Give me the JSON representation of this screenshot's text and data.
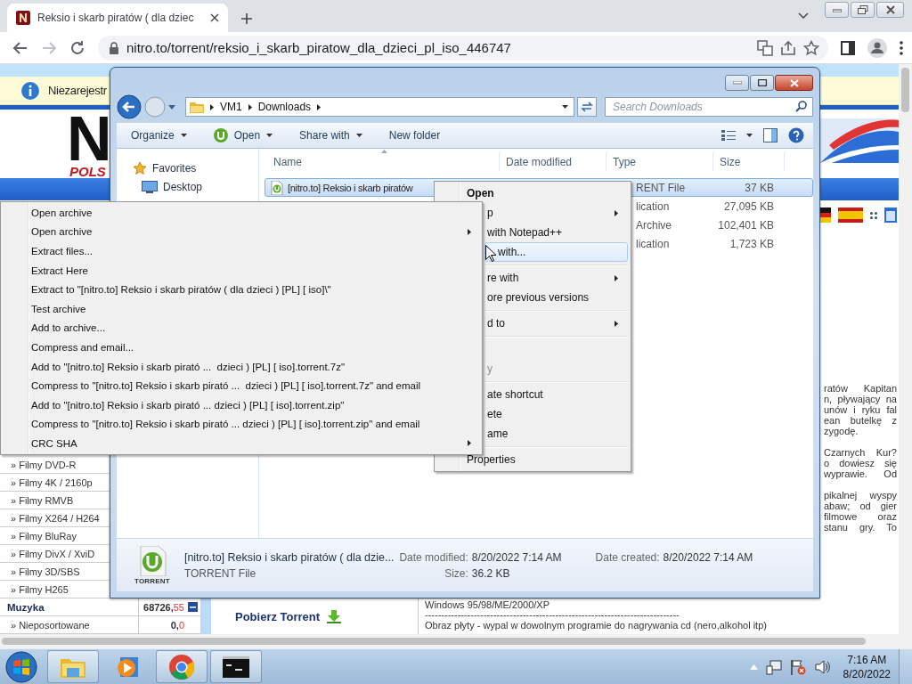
{
  "browser": {
    "tab_title": "Reksio i skarb piratów ( dla dziec",
    "url": "nitro.to/torrent/reksio_i_skarb_piratow_dla_dzieci_pl_iso_446747"
  },
  "site": {
    "info_bar": "Niezarejestr",
    "logo": "N",
    "logo_tagline": "POLS",
    "categories": [
      {
        "kind": "sub",
        "label": "» Filmy DVD-R"
      },
      {
        "kind": "sub",
        "label": "» Filmy 4K / 2160p"
      },
      {
        "kind": "sub",
        "label": "» Filmy RMVB"
      },
      {
        "kind": "sub",
        "label": "» Filmy X264 / H264"
      },
      {
        "kind": "sub",
        "label": "» Filmy BluRay"
      },
      {
        "kind": "sub",
        "label": "» Filmy DivX / XviD"
      },
      {
        "kind": "sub",
        "label": "» Filmy 3D/SBS"
      },
      {
        "kind": "sub",
        "label": "» Filmy H265"
      },
      {
        "kind": "main",
        "label": "Muzyka",
        "count": "68726,",
        "new": "55",
        "expanded": true
      },
      {
        "kind": "sub",
        "label": "» Nieposortowane",
        "count": "0,",
        "new": "0"
      }
    ],
    "download_link": "Pobierz Torrent",
    "description": [
      {
        "lines": [
          "ratów  Kapitan",
          "n, pływający na",
          "unów i ryku fal",
          "ean butelkę z",
          "zygodę."
        ]
      },
      {
        "lines": [
          "Czarnych Kur?",
          "o dowiesz się",
          "wyprawie. Od"
        ]
      },
      {
        "lines": [
          "pikalnej wyspy",
          "abaw; od gier",
          "filmowe oraz",
          "stanu gry. To"
        ]
      }
    ],
    "instructions": [
      "Windows 95/98/ME/2000/XP",
      "------------------------------------------------------------------------------",
      "Obraz płyty - wypal w dowolnym programie do nagrywania cd (nero,alkohol itp)"
    ]
  },
  "explorer": {
    "path": [
      "VM1",
      "Downloads"
    ],
    "search_placeholder": "Search Downloads",
    "toolbar": [
      {
        "label": "Organize",
        "kind": "plain",
        "dropdown": true
      },
      {
        "label": "Open",
        "kind": "app",
        "dropdown": true
      },
      {
        "label": "Share with",
        "kind": "plain",
        "dropdown": true
      },
      {
        "label": "New folder",
        "kind": "plain",
        "dropdown": false
      }
    ],
    "navigation": [
      {
        "kind": "favorites",
        "label": "Favorites"
      },
      {
        "kind": "desktop",
        "label": "Desktop"
      }
    ],
    "columns": [
      "Name",
      "Date modified",
      "Type",
      "Size"
    ],
    "files": [
      {
        "name": "[nitro.to] Reksio i skarb piratów",
        "type": "RENT File",
        "size": "37 KB",
        "selected": true
      },
      {
        "type": "lication",
        "size": "27,095 KB",
        "selected": false
      },
      {
        "type": "Archive",
        "size": "102,401 KB",
        "selected": false
      },
      {
        "type": "lication",
        "size": "1,723 KB",
        "selected": false
      }
    ],
    "details": {
      "icon_label": "TORRENT",
      "name": "[nitro.to] Reksio i skarb piratów ( dla dzie...",
      "type": "TORRENT File",
      "fields": [
        {
          "label": "Date modified:",
          "value": "8/20/2022 7:14 AM"
        },
        {
          "label": "Date created:",
          "value": "8/20/2022 7:14 AM"
        },
        {
          "label": "Size:",
          "value": "36.2 KB"
        }
      ]
    }
  },
  "context_menu": {
    "items": [
      {
        "kind": "item",
        "label": "Open",
        "default": true,
        "clipped": false,
        "submenu": false,
        "selected": false,
        "disabled": false
      },
      {
        "kind": "item",
        "label": "p",
        "default": false,
        "clipped": true,
        "submenu": true,
        "selected": false,
        "disabled": false
      },
      {
        "kind": "item",
        "label": "with Notepad++",
        "default": false,
        "clipped": true,
        "submenu": false,
        "selected": false,
        "disabled": false
      },
      {
        "kind": "item",
        "label": "with...",
        "default": false,
        "clipped": true,
        "submenu": false,
        "selected": true,
        "disabled": false
      },
      {
        "kind": "separator"
      },
      {
        "kind": "item",
        "label": "re with",
        "default": false,
        "clipped": true,
        "submenu": true,
        "selected": false,
        "disabled": false
      },
      {
        "kind": "item",
        "label": "ore previous versions",
        "default": false,
        "clipped": true,
        "submenu": false,
        "selected": false,
        "disabled": false
      },
      {
        "kind": "separator"
      },
      {
        "kind": "item",
        "label": "d to",
        "default": false,
        "clipped": true,
        "submenu": true,
        "selected": false,
        "disabled": false
      },
      {
        "kind": "separator"
      },
      {
        "kind": "covered"
      },
      {
        "kind": "item",
        "label": "y",
        "default": false,
        "clipped": true,
        "submenu": false,
        "selected": false,
        "disabled": true
      },
      {
        "kind": "separator"
      },
      {
        "kind": "item",
        "label": "ate shortcut",
        "default": false,
        "clipped": true,
        "submenu": false,
        "selected": false,
        "disabled": false
      },
      {
        "kind": "item",
        "label": "ete",
        "default": false,
        "clipped": true,
        "submenu": false,
        "selected": false,
        "disabled": false
      },
      {
        "kind": "item",
        "label": "ame",
        "default": false,
        "clipped": true,
        "submenu": false,
        "selected": false,
        "disabled": false
      },
      {
        "kind": "separator"
      },
      {
        "kind": "item",
        "label": "Properties",
        "default": false,
        "clipped": false,
        "submenu": false,
        "selected": false,
        "disabled": false
      }
    ]
  },
  "submenu": {
    "items": [
      {
        "label": "Open archive",
        "submenu": false
      },
      {
        "label": "Open archive",
        "submenu": true
      },
      {
        "label": "Extract files...",
        "submenu": false
      },
      {
        "label": "Extract Here",
        "submenu": false
      },
      {
        "label": "Extract to \"[nitro.to] Reksio i skarb piratów ( dla dzieci ) [PL] [ iso]\\\"",
        "submenu": false
      },
      {
        "label": "Test archive",
        "submenu": false
      },
      {
        "label": "Add to archive...",
        "submenu": false
      },
      {
        "label": "Compress and email...",
        "submenu": false
      },
      {
        "label": "Add to \"[nitro.to] Reksio i skarb pirató ...  dzieci ) [PL] [ iso].torrent.7z\"",
        "submenu": false
      },
      {
        "label": "Compress to \"[nitro.to] Reksio i skarb pirató ...  dzieci ) [PL] [ iso].torrent.7z\" and email",
        "submenu": false
      },
      {
        "label": "Add to \"[nitro.to] Reksio i skarb pirató ... dzieci ) [PL] [ iso].torrent.zip\"",
        "submenu": false
      },
      {
        "label": "Compress to \"[nitro.to] Reksio i skarb pirató ... dzieci ) [PL] [ iso].torrent.zip\" and email",
        "submenu": false
      },
      {
        "label": "CRC SHA",
        "submenu": true
      }
    ]
  },
  "taskbar": {
    "apps": [
      {
        "kind": "explorer",
        "open": true
      },
      {
        "kind": "media",
        "open": false
      },
      {
        "kind": "chrome",
        "open": true
      },
      {
        "kind": "cmd",
        "open": true
      }
    ],
    "time": "7:16 AM",
    "date": "8/20/2022"
  }
}
